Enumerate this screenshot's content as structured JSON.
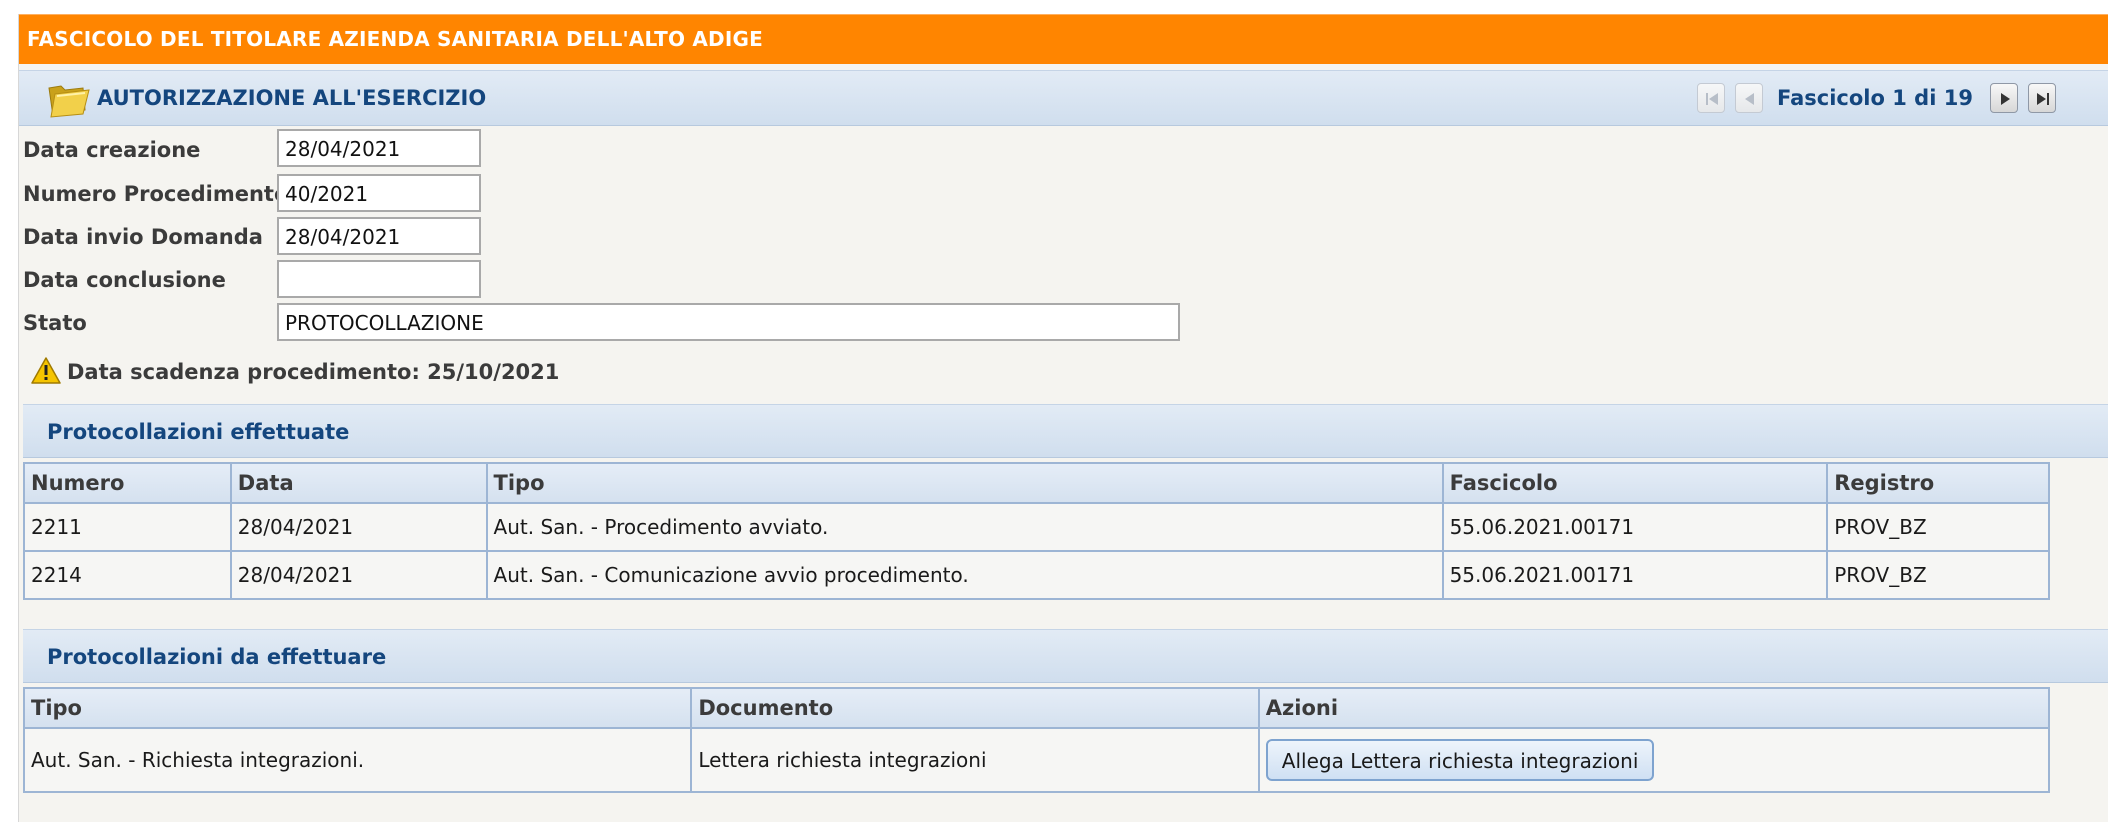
{
  "app": {
    "title": "FASCICOLO DEL TITOLARE AZIENDA SANITARIA DELL'ALTO ADIGE"
  },
  "main_section": {
    "title": "AUTORIZZAZIONE ALL'ESERCIZIO",
    "icon": "folder-icon"
  },
  "pager": {
    "text": "Fascicolo 1 di 19",
    "first_icon": "first-page-icon",
    "prev_icon": "previous-icon",
    "next_icon": "next-icon",
    "last_icon": "last-page-icon",
    "first_disabled": true,
    "prev_disabled": true
  },
  "form": {
    "creation_date": {
      "label": "Data creazione",
      "value": "28/04/2021"
    },
    "procedure_number": {
      "label": "Numero Procedimento",
      "value": "40/2021"
    },
    "submission_date": {
      "label": "Data invio Domanda",
      "value": "28/04/2021"
    },
    "conclusion_date": {
      "label": "Data conclusione",
      "value": ""
    },
    "status": {
      "label": "Stato",
      "value": "PROTOCOLLAZIONE"
    }
  },
  "deadline": {
    "icon": "warning-icon",
    "text": "Data scadenza procedimento: 25/10/2021"
  },
  "done_protocols": {
    "title": "Protocollazioni effettuate",
    "columns": [
      "Numero",
      "Data",
      "Tipo",
      "Fascicolo",
      "Registro"
    ],
    "rows": [
      [
        "2211",
        "28/04/2021",
        "Aut. San. - Procedimento avviato.",
        "55.06.2021.00171",
        "PROV_BZ"
      ],
      [
        "2214",
        "28/04/2021",
        "Aut. San. - Comunicazione avvio procedimento.",
        "55.06.2021.00171",
        "PROV_BZ"
      ]
    ]
  },
  "pending_protocols": {
    "title": "Protocollazioni da effettuare",
    "columns": [
      "Tipo",
      "Documento",
      "Azioni"
    ],
    "rows": [
      {
        "type": "Aut. San. - Richiesta integrazioni.",
        "document": "Lettera richiesta integrazioni",
        "action_label": "Allega Lettera richiesta integrazioni"
      }
    ]
  },
  "colors": {
    "header_orange": "#ff8500",
    "title_blue": "#14467e",
    "grid_border": "#9db5d4"
  }
}
